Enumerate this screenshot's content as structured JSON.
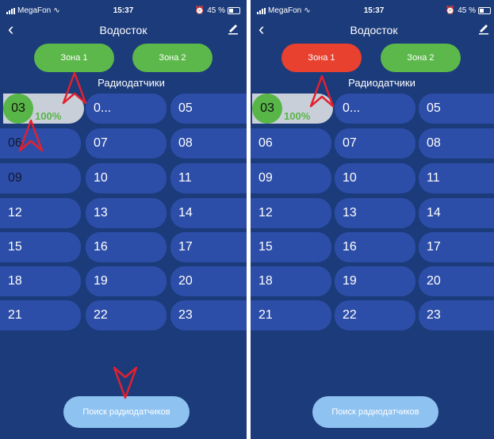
{
  "screens": [
    {
      "status": {
        "carrier": "MegaFon",
        "time": "15:37",
        "battery": "45 %"
      },
      "header": {
        "title": "Водосток",
        "back_icon": "chevron-left-icon",
        "edit_icon": "pencil-icon"
      },
      "zones": [
        {
          "label": "Зона 1",
          "color": "#5cb84a"
        },
        {
          "label": "Зона 2",
          "color": "#5cb84a"
        }
      ],
      "section_title": "Радиодатчики",
      "selected_sensor": {
        "number": "03",
        "percent": "100%"
      },
      "sensors": [
        "0...",
        "05",
        "06",
        "07",
        "08",
        "09",
        "10",
        "11",
        "12",
        "13",
        "14",
        "15",
        "16",
        "17",
        "18",
        "19",
        "20",
        "21",
        "22",
        "23"
      ],
      "search_button": "Поиск радиодатчиков"
    },
    {
      "status": {
        "carrier": "MegaFon",
        "time": "15:37",
        "battery": "45 %"
      },
      "header": {
        "title": "Водосток",
        "back_icon": "chevron-left-icon",
        "edit_icon": "pencil-icon"
      },
      "zones": [
        {
          "label": "Зона 1",
          "color": "#e8412f"
        },
        {
          "label": "Зона 2",
          "color": "#5cb84a"
        }
      ],
      "section_title": "Радиодатчики",
      "selected_sensor": {
        "number": "03",
        "percent": "100%"
      },
      "sensors": [
        "0...",
        "05",
        "06",
        "07",
        "08",
        "09",
        "10",
        "11",
        "12",
        "13",
        "14",
        "15",
        "16",
        "17",
        "18",
        "19",
        "20",
        "21",
        "22",
        "23"
      ],
      "search_button": "Поиск радиодатчиков"
    }
  ]
}
